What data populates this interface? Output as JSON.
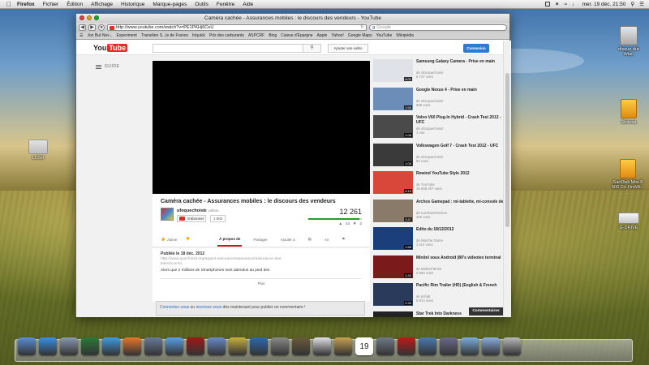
{
  "menubar": {
    "items": [
      "Firefox",
      "Fichier",
      "Édition",
      "Affichage",
      "Historique",
      "Marque-pages",
      "Outils",
      "Fenêtre",
      "Aide"
    ],
    "clock": "mer. 19 déc.  21:50"
  },
  "desktop": {
    "icons": [
      {
        "label": "disque dur\niMac"
      },
      {
        "label": "Storeva"
      },
      {
        "label": "SanDisk Mini 8\n500 Go FireWi..."
      },
      {
        "label": "G-DRIVE"
      },
      {
        "label": "LUSH"
      }
    ]
  },
  "browser": {
    "title": "Caméra cachée - Assurances mobiles : le discours des vendeurs - YouTube",
    "url": "http://www.youtube.com/watch?v=PE1PKHj6CeU",
    "search_placeholder": "Google",
    "bookmarks": [
      "Jon But Nev...",
      "Experiment",
      "Transilien S...le de France",
      "Iriquick",
      "Prix des carburants",
      "ASPCRF",
      "Bing",
      "Caisse d'Epargne",
      "Apple",
      "Yahoo!",
      "Google Maps",
      "YouTube",
      "Wikipédia"
    ]
  },
  "youtube": {
    "logo_you": "You",
    "logo_tube": "Tube",
    "upload_label": "Ajouter une vidéo",
    "connexion_label": "Connexion",
    "guide_label": "GUIDE",
    "video": {
      "title": "Caméra cachée - Assurances mobiles : le discours des vendeurs",
      "channel": "ufoquechoisir",
      "video_count": "· 281 vidéos",
      "subscribe_label": "S'abonner",
      "subscriber_count": "1 582",
      "views": "12 261",
      "like_ratio": 0.95,
      "likes": "44",
      "dislikes": "2",
      "like_label": "J'aime",
      "tabs": [
        "À propos de",
        "Partager",
        "Ajouter à",
        "",
        "Air",
        "Bq"
      ]
    },
    "description": {
      "published": "Publiée le 18 déc. 2012",
      "link": "http://www.quechoisir.org/argent-assurance/assurance/assurance-des-biens/comm...",
      "text": "Alors que 2 millions de Smartphones sont attendus au pied des",
      "more_label": "Plus"
    },
    "comment": {
      "login_link": "Connectez-vous",
      "or_text": " ou ",
      "register_link": "inscrivez-vous",
      "rest": " dès maintenant pour publier un commentaire !"
    },
    "commentaires_label": "Commentaires",
    "suggestions": [
      {
        "title": "Samsung Galaxy Camera - Prise en main",
        "channel": "de ufocquechoisir",
        "views": "6 737 vues",
        "duration": "4:01",
        "color": "#dfe3e8"
      },
      {
        "title": "Google Nexus 4 - Prise en main",
        "channel": "de ufocquechoisir",
        "views": "838 vues",
        "duration": "3:58",
        "color": "#6b8db8"
      },
      {
        "title": "Volvo V60 Plug-In Hybrid - Crash Test 2012 - UFC",
        "channel": "de ufocquechoisir",
        "views": "1 vue",
        "duration": "1:06",
        "color": "#4a4a4a"
      },
      {
        "title": "Volkswagen Golf 7 - Crash Test 2012 - UFC",
        "channel": "de ufocquechoisir",
        "views": "94 vues",
        "duration": "1:08",
        "color": "#3a3a3a"
      },
      {
        "title": "Rewind YouTube Style 2012",
        "channel": "de YouTube",
        "views": "16 848 207 vues",
        "duration": "4:15",
        "color": "#d9463a"
      },
      {
        "title": "Archos Gamepad : mi-tablette, mi-console de",
        "channel": "de LaChaineTechno",
        "views": "332 vues",
        "duration": "2:47",
        "color": "#8a7a6a"
      },
      {
        "title": "Edito du 18/12/2012",
        "channel": "de Marche Dome",
        "views": "3 114 vues",
        "duration": "1:58",
        "color": "#1a3f7a"
      },
      {
        "title": "Minitel sous Android (80's videotex terminal",
        "channel": "de MarkePatrise",
        "views": "3 590 vues",
        "duration": "2:45",
        "color": "#7a1a1a"
      },
      {
        "title": "Pacific Rim Trailer (HD) (English & French",
        "channel": "de pchidr",
        "views": "5 814 vues",
        "duration": "2:35",
        "color": "#2a3a5a"
      },
      {
        "title": "Star Trek Into Darkness",
        "channel": "",
        "views": "",
        "duration": "",
        "color": "#222222"
      }
    ]
  },
  "dock": {
    "apps": [
      "finder-icon",
      "app-store-icon",
      "system-icon",
      "clock-icon",
      "safari-icon",
      "firefox-icon",
      "photos-icon",
      "itunes-icon",
      "photo-booth-icon",
      "preview-icon",
      "game-icon",
      "quicktime-icon",
      "chess-icon",
      "books-icon",
      "mail-icon",
      "contacts-icon",
      "calendar-icon",
      "tools-icon",
      "opera-icon",
      "utilities-icon",
      "music-icon",
      "folder-icon",
      "downloads-icon",
      "trash-icon"
    ],
    "calendar_day": "19"
  }
}
